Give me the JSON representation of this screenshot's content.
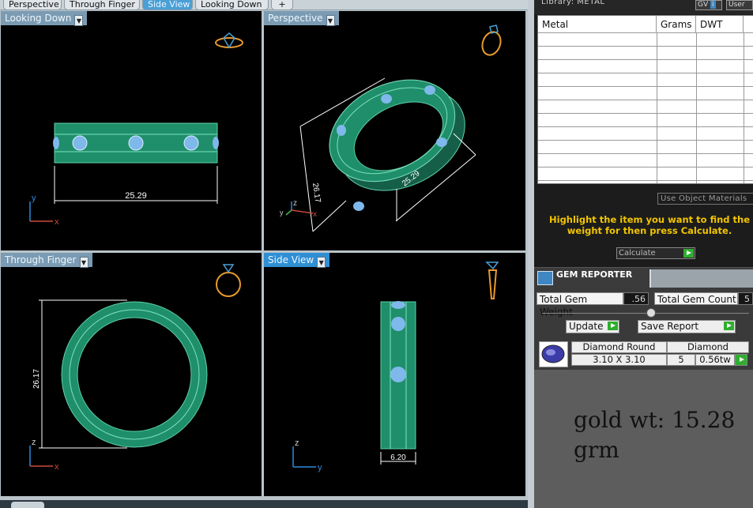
{
  "tabs": [
    {
      "label": "Perspective",
      "active": false
    },
    {
      "label": "Through Finger",
      "active": false
    },
    {
      "label": "Side View",
      "active": true
    },
    {
      "label": "Looking Down",
      "active": false
    },
    {
      "label": "+",
      "active": false
    }
  ],
  "viewports": {
    "top_left": {
      "title": "Looking Down",
      "dimension": "25.29",
      "axis_v": "y",
      "axis_h": "x"
    },
    "top_right": {
      "title": "Perspective",
      "dimension_a": "26.17",
      "dimension_b": "25.29",
      "axis_v": "z",
      "axis_h": "x",
      "axis_d": "y"
    },
    "bottom_left": {
      "title": "Through Finger",
      "dimension": "26.17",
      "axis_v": "z",
      "axis_h": "x"
    },
    "bottom_right": {
      "title": "Side View",
      "dimension": "6.20",
      "axis_v": "z",
      "axis_h": "y"
    }
  },
  "library": {
    "label": "Library: METAL",
    "buttons": [
      "GV",
      "i",
      "User"
    ],
    "columns": [
      "Metal",
      "Grams",
      "DWT"
    ],
    "use_object_materials": "Use Object Materials"
  },
  "instructions": "Highlight the item you want to find the weight for then press Calculate.",
  "calculate_label": "Calculate",
  "gem_reporter": {
    "title": "GEM REPORTER",
    "total_gem_weight_label": "Total Gem Weight",
    "total_gem_weight": ".56",
    "total_gem_count_label": "Total Gem Count",
    "total_gem_count": "5",
    "update_label": "Update",
    "save_report_label": "Save Report",
    "gem": {
      "shape": "Diamond Round",
      "size": "3.10 X 3.10",
      "type": "Diamond",
      "count": "5",
      "weight": "0.56tw"
    }
  },
  "note_line1": "gold wt: 15.28",
  "note_line2": "grm",
  "colors": {
    "ring_green": "#1e8f6a",
    "stone_blue": "#7fb8ea",
    "dimension": "#ffffff",
    "highlight_text": "#f2c500",
    "active_tab": "#4a9fd6"
  }
}
